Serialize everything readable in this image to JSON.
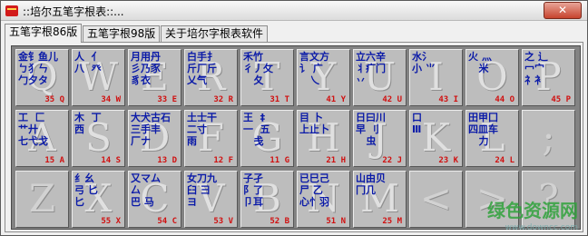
{
  "window": {
    "title": "::培尔五笔字根表::...",
    "close_label": "✕"
  },
  "tabs": [
    {
      "label": "五笔字根86版"
    },
    {
      "label": "五笔字根98版"
    },
    {
      "label": "关于培尔字根表软件"
    }
  ],
  "keys": [
    {
      "letter": "Q",
      "roots": "金钅鱼儿\nㄅ犭ㄣ\n勹夕タ",
      "code": "35 Q"
    },
    {
      "letter": "W",
      "roots": "人  亻\n八  癶\n       ",
      "code": "34 W"
    },
    {
      "letter": "E",
      "roots": "月用丹\n彡乃豕\n豸衣",
      "code": "33 E"
    },
    {
      "letter": "R",
      "roots": "白手扌\n斤厂斤\n乂气",
      "code": "32 R"
    },
    {
      "letter": "T",
      "roots": "禾竹\n彳丿攵\n   夂",
      "code": "31 T"
    },
    {
      "letter": "Y",
      "roots": "言文方\n讠 广\n   乀",
      "code": "41 Y"
    },
    {
      "letter": "U",
      "roots": "立六辛\n丬疒门\n丷 ",
      "code": "42 U"
    },
    {
      "letter": "I",
      "roots": "水氵\n小 ⺌\n   ",
      "code": "43 I"
    },
    {
      "letter": "O",
      "roots": "火 灬\n   米\n   ",
      "code": "44 O"
    },
    {
      "letter": "P",
      "roots": "之 辶\n冖宀\n礻衤",
      "code": "45 P"
    },
    {
      "letter": "A",
      "roots": "工  匚\n艹廾\n七弋戈",
      "code": "15 A"
    },
    {
      "letter": "S",
      "roots": "木  丁\n西\n   ",
      "code": "14 S"
    },
    {
      "letter": "D",
      "roots": "大犬古石\n三手丰\n厂ナ",
      "code": "13 D"
    },
    {
      "letter": "F",
      "roots": "土士干\n二寸\n雨  ",
      "code": "12 F"
    },
    {
      "letter": "G",
      "roots": "王  ‡\n一  五\n   戋",
      "code": "11 G"
    },
    {
      "letter": "H",
      "roots": "目 卜\n上止卜\n   ",
      "code": "21 H"
    },
    {
      "letter": "J",
      "roots": "日曰川\n早 刂\n   虫",
      "code": "22 J"
    },
    {
      "letter": "K",
      "roots": "口\nⅢ\n   ",
      "code": "23 K"
    },
    {
      "letter": "L",
      "roots": "田甲囗\n四皿车\n   力",
      "code": "24 L"
    },
    {
      "letter": ";",
      "roots": "",
      "code": ""
    },
    {
      "letter": "Z",
      "roots": "",
      "code": ""
    },
    {
      "letter": "X",
      "roots": "纟幺\n弓 匕\n匕",
      "code": "55 X"
    },
    {
      "letter": "C",
      "roots": "又マム\n厶\n巴 马",
      "code": "54 C"
    },
    {
      "letter": "V",
      "roots": "女刀九\n臼 彐\nヨ  ",
      "code": "53 V"
    },
    {
      "letter": "B",
      "roots": "子孑\n阝了\n卩耳",
      "code": "52 B"
    },
    {
      "letter": "N",
      "roots": "已巳己\n尸 乙\n心忄羽",
      "code": "51 N"
    },
    {
      "letter": "M",
      "roots": "山由贝\n冂几\n   ",
      "code": "25 M"
    },
    {
      "letter": "<",
      "roots": "",
      "code": ""
    },
    {
      "letter": ">",
      "roots": "",
      "code": ""
    },
    {
      "letter": "?",
      "roots": "",
      "code": ""
    }
  ],
  "watermark": {
    "line1": "绿色资源网",
    "line2": "www.downcc.com"
  }
}
